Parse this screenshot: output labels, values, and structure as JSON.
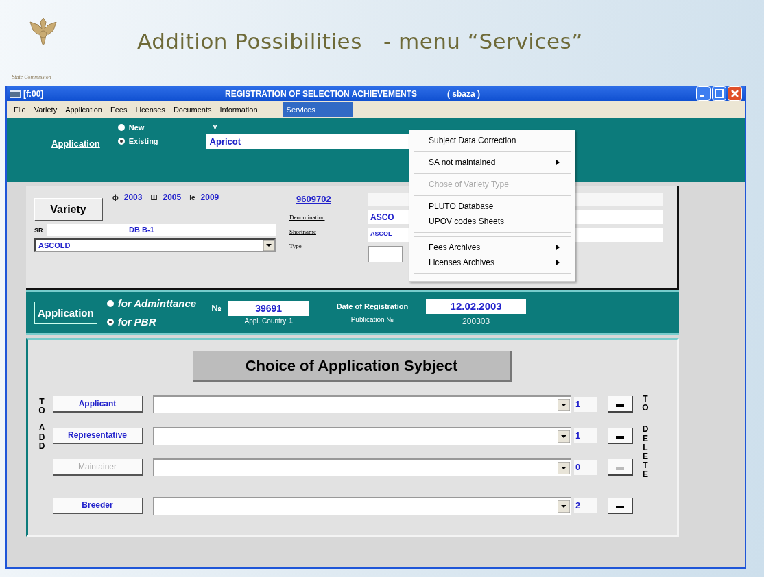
{
  "slide": {
    "title": "Addition Possibilities   - menu “Services”",
    "logo_caption": "State Commission"
  },
  "window": {
    "code": "[f:00]",
    "title": "REGISTRATION OF SELECTION ACHIEVEMENTS",
    "user": "( sbaza )"
  },
  "menu_bar": [
    {
      "label": "File",
      "selected": false
    },
    {
      "label": "Variety",
      "selected": false
    },
    {
      "label": "Application",
      "selected": false
    },
    {
      "label": "Fees",
      "selected": false
    },
    {
      "label": "Licenses",
      "selected": false
    },
    {
      "label": "Documents",
      "selected": false
    },
    {
      "label": "Information",
      "selected": false
    },
    {
      "label": "Services",
      "selected": true
    }
  ],
  "services_menu": [
    {
      "kind": "item",
      "label": "Subject Data Correction",
      "submenu": false,
      "disabled": false
    },
    {
      "kind": "separator"
    },
    {
      "kind": "item",
      "label": "SA not maintained",
      "submenu": true,
      "disabled": false
    },
    {
      "kind": "separator"
    },
    {
      "kind": "item",
      "label": "Chose of Variety Type",
      "submenu": false,
      "disabled": true
    },
    {
      "kind": "separator"
    },
    {
      "kind": "item",
      "label": "PLUTO Database",
      "submenu": false,
      "disabled": false
    },
    {
      "kind": "item",
      "label": "UPOV codes Sheets",
      "submenu": false,
      "disabled": false
    },
    {
      "kind": "separator"
    },
    {
      "kind": "separator"
    },
    {
      "kind": "item",
      "label": "Fees Archives",
      "submenu": true,
      "disabled": false
    },
    {
      "kind": "item",
      "label": "Licenses Archives",
      "submenu": true,
      "disabled": false
    },
    {
      "kind": "separator"
    }
  ],
  "application_bar": {
    "link": "Application",
    "options": [
      {
        "label": "New",
        "selected": false
      },
      {
        "label": "Existing",
        "selected": true
      }
    ],
    "marker": "v",
    "value": "Apricot"
  },
  "variety": {
    "button": "Variety",
    "years": [
      {
        "symbol": "ф",
        "value": "2003"
      },
      {
        "symbol": "Ш",
        "value": "2005"
      },
      {
        "symbol": "le",
        "value": "2009"
      }
    ],
    "number": "9609702",
    "code_label": "SR",
    "code_value": "DB B-1",
    "select_value": "ASCOLD",
    "fields": [
      {
        "label": "Denomination",
        "value": "ASCO"
      },
      {
        "label": "Shortname",
        "value": "ASCOL"
      },
      {
        "label": "Type"
      }
    ]
  },
  "registration": {
    "button": "Application",
    "options": [
      {
        "label": "for Adminttance",
        "selected": false
      },
      {
        "label": "for PBR",
        "selected": true
      }
    ],
    "number_label": "№",
    "number": "39691",
    "country_label": "Appl. Country",
    "country": "1",
    "date_label": "Date of Registration",
    "date": "12.02.2003",
    "publication_label": "Publication №",
    "publication": "200303"
  },
  "subjects": {
    "title": "Choice of Application Sybject",
    "add_label": [
      "TO",
      "ADD"
    ],
    "delete_label": [
      "TO",
      "DELETE"
    ],
    "rows": [
      {
        "label": "Applicant",
        "count": "1",
        "disabled": false
      },
      {
        "label": "Representative",
        "count": "1",
        "disabled": false
      },
      {
        "label": "Maintainer",
        "count": "0",
        "disabled": true
      },
      {
        "label": "Breeder",
        "count": "2",
        "disabled": false
      }
    ]
  }
}
